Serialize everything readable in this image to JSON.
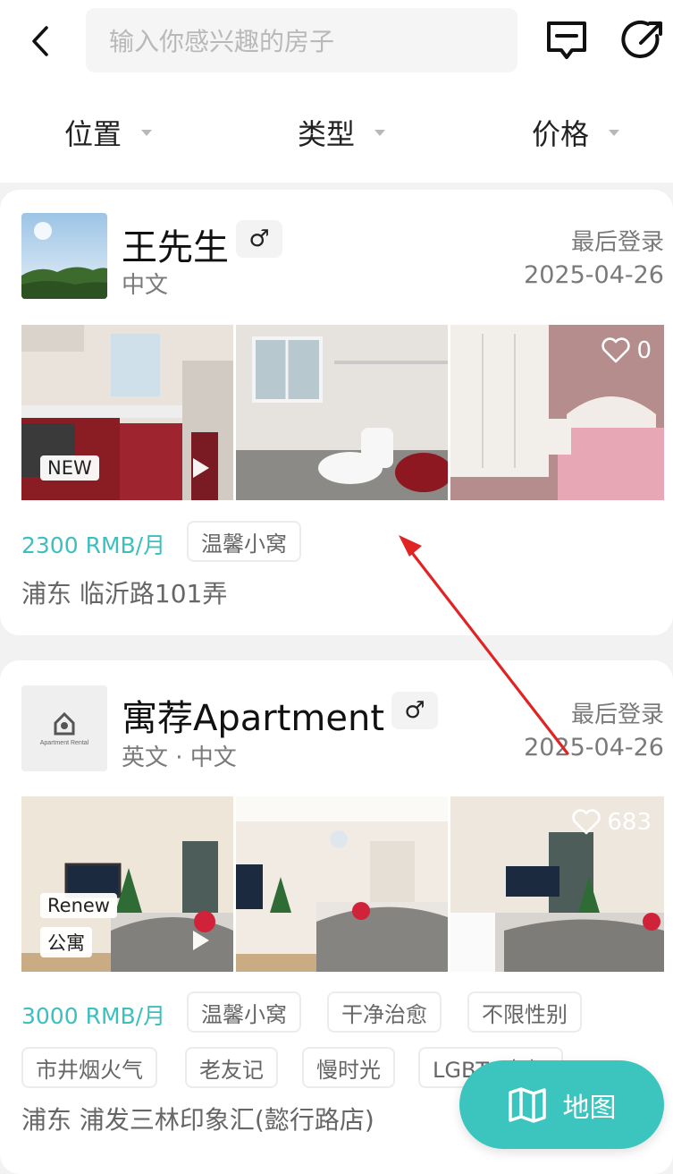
{
  "search": {
    "placeholder": "输入你感兴趣的房子"
  },
  "filters": [
    {
      "label": "位置"
    },
    {
      "label": "类型"
    },
    {
      "label": "价格"
    }
  ],
  "listings": [
    {
      "name": "王先生",
      "gender_symbol": "♂",
      "languages": "中文",
      "last_login_label": "最后登录",
      "last_login_date": "2025-04-26",
      "photo_badges": [
        "NEW"
      ],
      "likes": "0",
      "price": "2300 RMB/月",
      "tags": [
        "温馨小窝"
      ],
      "address": "浦东 临沂路101弄"
    },
    {
      "name": "寓荐Apartment",
      "gender_symbol": "♂",
      "languages": "英文 · 中文",
      "last_login_label": "最后登录",
      "last_login_date": "2025-04-26",
      "photo_badges": [
        "Renew",
        "公寓"
      ],
      "likes": "683",
      "price": "3000 RMB/月",
      "tags": [
        "温馨小窝",
        "干净治愈",
        "不限性别",
        "市井烟火气",
        "老友记",
        "慢时光",
        "LGBTQ友好"
      ],
      "address": "浦东 浦发三林印象汇(懿行路店)",
      "avatar_text": "Apartment Rental"
    }
  ],
  "map_button": {
    "label": "地图"
  },
  "colors": {
    "accent": "#3cc4be",
    "price": "#3bbfbf",
    "annotation_arrow": "#e02424"
  }
}
